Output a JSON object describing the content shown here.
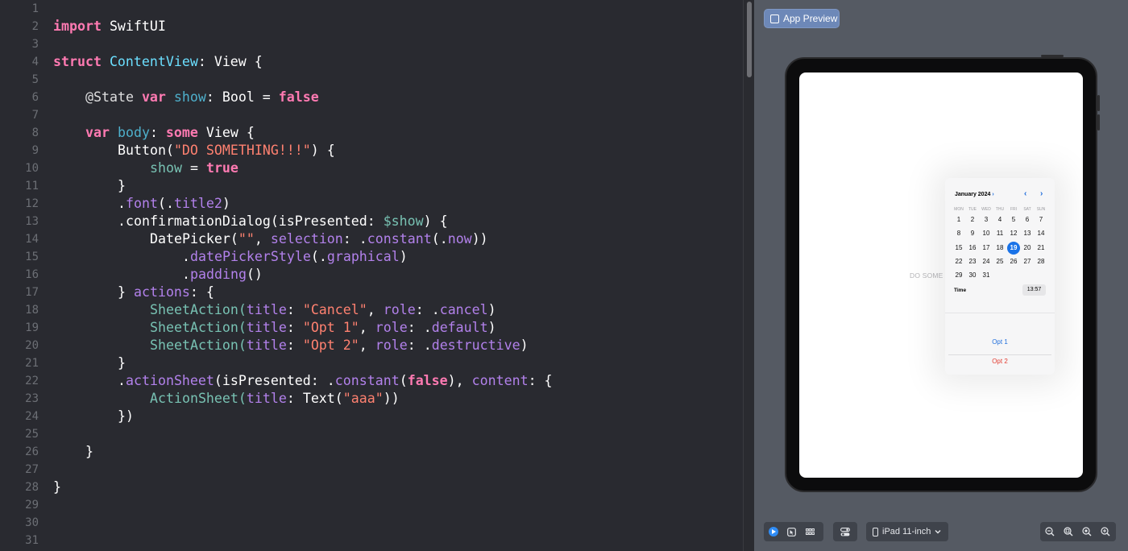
{
  "editor": {
    "line_numbers": [
      "1",
      "2",
      "3",
      "4",
      "5",
      "6",
      "7",
      "8",
      "9",
      "10",
      "11",
      "12",
      "13",
      "14",
      "15",
      "16",
      "17",
      "18",
      "19",
      "20",
      "21",
      "22",
      "23",
      "24",
      "25",
      "26",
      "27",
      "28",
      "29",
      "30",
      "31"
    ],
    "code": {
      "l2": [
        "import",
        " SwiftUI"
      ],
      "l4": [
        "struct",
        " ContentView",
        ": View {"
      ],
      "l6": [
        "@State",
        " var",
        " show",
        ": Bool = ",
        "false"
      ],
      "l8": [
        "var",
        " body",
        ": ",
        "some",
        " View {"
      ],
      "l9": [
        "Button(",
        "\"DO SOMETHING!!!\"",
        ") {"
      ],
      "l10": [
        "show",
        " = ",
        "true"
      ],
      "l11": [
        "}"
      ],
      "l12": [
        ".",
        "font",
        "(.",
        "title2",
        ")"
      ],
      "l13": [
        ".confirmationDialog(isPresented: ",
        "$show",
        ") {"
      ],
      "l14": [
        "DatePicker(",
        "\"\"",
        ", ",
        "selection",
        ": .",
        "constant",
        "(.",
        "now",
        "))"
      ],
      "l15": [
        ".",
        "datePickerStyle",
        "(.",
        "graphical",
        ")"
      ],
      "l16": [
        ".",
        "padding",
        "()"
      ],
      "l17": [
        "} ",
        "actions",
        ": {"
      ],
      "l18": [
        "SheetAction(",
        "title",
        ": ",
        "\"Cancel\"",
        ", ",
        "role",
        ": .",
        "cancel",
        ")"
      ],
      "l19": [
        "SheetAction(",
        "title",
        ": ",
        "\"Opt 1\"",
        ", ",
        "role",
        ": .",
        "default",
        ")"
      ],
      "l20": [
        "SheetAction(",
        "title",
        ": ",
        "\"Opt 2\"",
        ", ",
        "role",
        ": .",
        "destructive",
        ")"
      ],
      "l21": [
        "}"
      ],
      "l22": [
        ".",
        "actionSheet",
        "(isPresented: .",
        "constant",
        "(",
        "false",
        "), ",
        "content",
        ": {"
      ],
      "l23": [
        "ActionSheet(",
        "title",
        ": Text(",
        "\"aaa\"",
        "))"
      ],
      "l24": [
        "})"
      ],
      "l26": [
        "}"
      ],
      "l28": [
        "}"
      ]
    }
  },
  "preview": {
    "button_label": "App Preview",
    "background_text": "DO SOME",
    "calendar": {
      "month_label": "January 2024",
      "month_chevron": "›",
      "prev": "‹",
      "next": "›",
      "weekdays": [
        "MON",
        "TUE",
        "WED",
        "THU",
        "FRI",
        "SAT",
        "SUN"
      ],
      "weeks": [
        [
          "1",
          "2",
          "3",
          "4",
          "5",
          "6",
          "7"
        ],
        [
          "8",
          "9",
          "10",
          "11",
          "12",
          "13",
          "14"
        ],
        [
          "15",
          "16",
          "17",
          "18",
          "19",
          "20",
          "21"
        ],
        [
          "22",
          "23",
          "24",
          "25",
          "26",
          "27",
          "28"
        ],
        [
          "29",
          "30",
          "31"
        ]
      ],
      "selected_day": "19",
      "time_label": "Time",
      "time_value": "13:57"
    },
    "options": [
      "Opt 1",
      "Opt 2"
    ],
    "option_colors": {
      "default": "#1e6ddc",
      "destructive": "#e23b30"
    }
  },
  "toolbar": {
    "device_label": "iPad 11-inch",
    "icons": [
      "play-icon",
      "select-icon",
      "grid-icon",
      "variants-icon",
      "zoom-out-icon",
      "zoom-fit-icon",
      "zoom-actual-icon",
      "zoom-in-icon"
    ]
  }
}
